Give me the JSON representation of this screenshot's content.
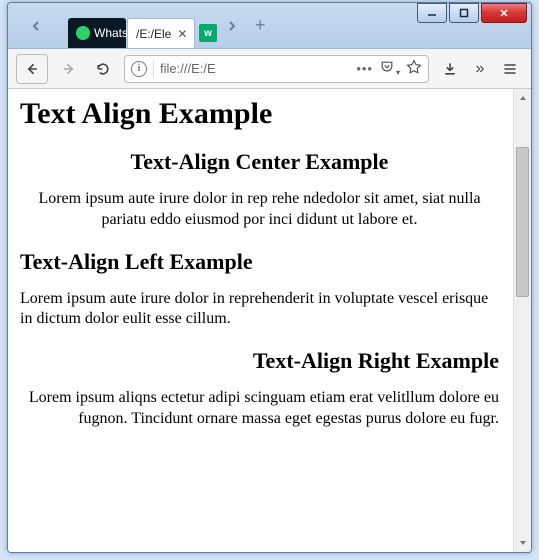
{
  "window": {
    "titlebar_chevrons": {
      "left": "chevron-left",
      "right": "chevron-right"
    }
  },
  "tabs": {
    "whatsapp": {
      "label": "Whats"
    },
    "file": {
      "label": "/E:/Ele",
      "close_glyph": "✕"
    },
    "w3": {
      "label": "w"
    },
    "new_tab_glyph": "+",
    "overflow_chevron": "›"
  },
  "winbuttons": {
    "minimize": "minimize",
    "maximize": "maximize",
    "close": "close"
  },
  "toolbar": {
    "back": "back",
    "forward": "forward",
    "reload": "reload",
    "url_info_glyph": "i",
    "url_text": "file:///E:/E",
    "actions_dots": "•••",
    "pocket": "pocket",
    "star": "star",
    "download": "download",
    "overflow_glyph": "»",
    "menu": "menu"
  },
  "page": {
    "h1": "Text Align Example",
    "sections": {
      "center": {
        "heading": "Text-Align Center Example",
        "body": "Lorem ipsum aute irure dolor in rep rehe ndedolor sit amet, siat nulla pariatu eddo eiusmod por inci didunt ut labore et."
      },
      "left": {
        "heading": "Text-Align Left Example",
        "body": "Lorem ipsum aute irure dolor in reprehenderit in voluptate vescel erisque in dictum dolor eulit esse cillum."
      },
      "right": {
        "heading": "Text-Align Right Example",
        "body": "Lorem ipsum aliqns ectetur adipi scinguam etiam erat velitllum dolore eu fugnon. Tincidunt ornare massa eget egestas purus dolore eu fugr."
      }
    }
  },
  "colors": {
    "window_border": "#5a7fa8",
    "titlebar_bg_top": "#c7dbf0",
    "titlebar_bg_bottom": "#b7cde6",
    "close_red": "#d73838",
    "whatsapp_green": "#25d366",
    "w3_green": "#04aa6d"
  }
}
